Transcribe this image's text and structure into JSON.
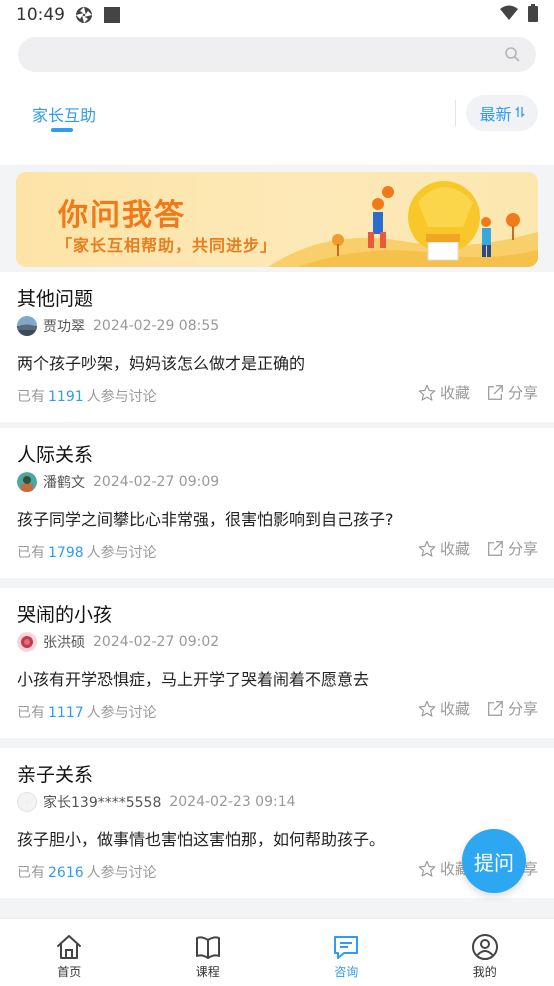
{
  "status_bar": {
    "time": "10:49"
  },
  "search": {
    "value": "",
    "placeholder": ""
  },
  "tabs": {
    "active": "家长互助",
    "sort_label": "最新"
  },
  "banner": {
    "title": "你问我答",
    "subtitle": "「家长互相帮助，共同进步」"
  },
  "posts": [
    {
      "category": "其他问题",
      "author": "贾功翠",
      "date": "2024-02-29 08:55",
      "question": "两个孩子吵架，妈妈该怎么做才是正确的",
      "prefix": "已有",
      "count": "1191",
      "suffix": "人参与讨论",
      "collect": "收藏",
      "share": "分享"
    },
    {
      "category": "人际关系",
      "author": "潘鹤文",
      "date": "2024-02-27 09:09",
      "question": "孩子同学之间攀比心非常强，很害怕影响到自己孩子?",
      "prefix": "已有",
      "count": "1798",
      "suffix": "人参与讨论",
      "collect": "收藏",
      "share": "分享"
    },
    {
      "category": "哭闹的小孩",
      "author": "张洪硕",
      "date": "2024-02-27 09:02",
      "question": "小孩有开学恐惧症，马上开学了哭着闹着不愿意去",
      "prefix": "已有",
      "count": "1117",
      "suffix": "人参与讨论",
      "collect": "收藏",
      "share": "分享"
    },
    {
      "category": "亲子关系",
      "author": "家长139****5558",
      "date": "2024-02-23 09:14",
      "question": "孩子胆小，做事情也害怕这害怕那，如何帮助孩子。",
      "prefix": "已有",
      "count": "2616",
      "suffix": "人参与讨论",
      "collect": "收藏",
      "share": "分享"
    }
  ],
  "fab": {
    "label": "提问"
  },
  "nav": [
    {
      "label": "首页",
      "icon": "home-icon"
    },
    {
      "label": "课程",
      "icon": "book-icon"
    },
    {
      "label": "咨询",
      "icon": "chat-icon",
      "active": true
    },
    {
      "label": "我的",
      "icon": "profile-icon"
    }
  ]
}
